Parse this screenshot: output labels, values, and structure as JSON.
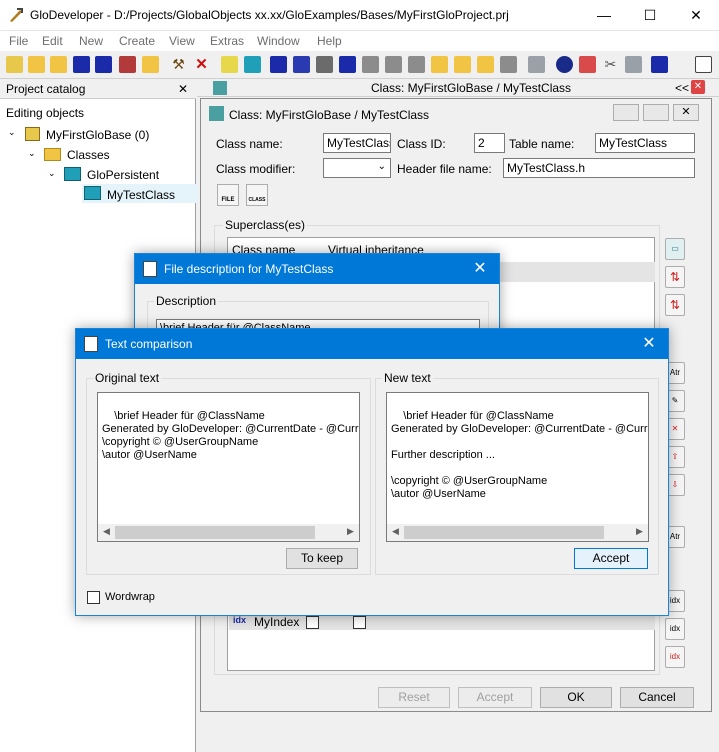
{
  "app": {
    "title": "GloDeveloper - D:/Projects/GlobalObjects xx.xx/GloExamples/Bases/MyFirstGloProject.prj",
    "window_controls": [
      "—",
      "☐",
      "✕"
    ]
  },
  "menu": [
    "File",
    "Edit",
    "New",
    "Create",
    "View",
    "Extras",
    "Window",
    "Help"
  ],
  "project_catalog": {
    "title": "Project catalog",
    "close": "✕",
    "section": "Editing objects",
    "tree": [
      {
        "label": "MyFirstGloBase (0)",
        "icon": "database-icon"
      },
      {
        "label": "Classes",
        "icon": "folder-icon"
      },
      {
        "label": "GloPersistent",
        "icon": "class-icon"
      },
      {
        "label": "MyTestClass",
        "icon": "class-icon"
      }
    ]
  },
  "mdi_tab": {
    "title": "Class: MyFirstGloBase / MyTestClass",
    "nav": "<<"
  },
  "class_window": {
    "title": "Class: MyFirstGloBase / MyTestClass",
    "class_name_label": "Class name:",
    "class_name": "MyTestClass",
    "class_id_label": "Class ID:",
    "class_id": "2",
    "table_name_label": "Table name:",
    "table_name": "MyTestClass",
    "class_modifier_label": "Class modifier:",
    "class_modifier": "",
    "header_file_label": "Header file name:",
    "header_file": "MyTestClass.h",
    "file_btn": "FILE",
    "class_btn": "CLASS",
    "superclass_label": "Superclass(es)",
    "superclass_col1": "Class name",
    "superclass_col2": "Virtual inheritance",
    "index_row": "MyIndex",
    "reset": "Reset",
    "accept": "Accept",
    "ok": "OK",
    "cancel": "Cancel"
  },
  "file_desc_dialog": {
    "title": "File description for MyTestClass",
    "close": "✕",
    "group_label": "Description",
    "text_preview": "\\brief Header für @ClassName"
  },
  "compare_dialog": {
    "title": "Text comparison",
    "close": "✕",
    "original_label": "Original text",
    "new_label": "New text",
    "original_text": "\\brief Header für @ClassName\nGenerated by GloDeveloper: @CurrentDate - @CurrentTime\n\\copyright © @UserGroupName\n\\autor @UserName",
    "new_text": "\\brief Header für @ClassName\nGenerated by GloDeveloper: @CurrentDate - @CurrentTime\n\nFurther description ...\n\n\\copyright © @UserGroupName\n\\autor @UserName",
    "to_keep": "To keep",
    "accept": "Accept",
    "wordwrap": "Wordwrap"
  },
  "colors": {
    "accent": "#0078d7",
    "selection": "#cce8ff"
  }
}
